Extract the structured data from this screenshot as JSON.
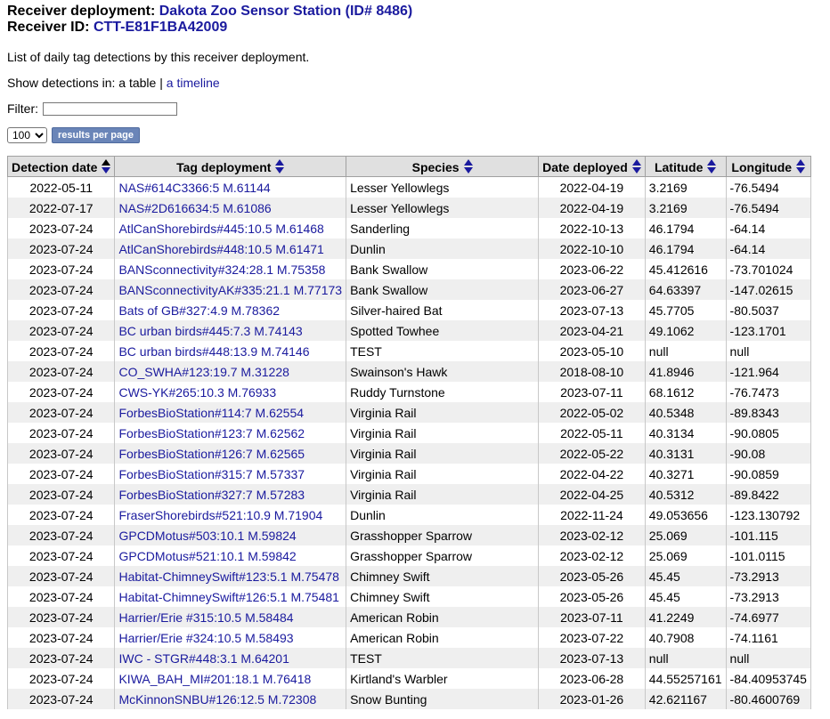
{
  "header": {
    "deployment_label": "Receiver deployment:",
    "deployment_name": "Dakota Zoo Sensor Station (ID# 8486)",
    "receiver_label": "Receiver ID:",
    "receiver_id": "CTT-E81F1BA42009"
  },
  "description": "List of daily tag detections by this receiver deployment.",
  "show": {
    "prefix": "Show detections in: ",
    "table_text": "a table",
    "separator": " | ",
    "timeline_text": "a timeline"
  },
  "filter": {
    "label": "Filter:",
    "value": "",
    "placeholder": ""
  },
  "pager": {
    "page_size": "100",
    "button_label": "results per page"
  },
  "table": {
    "columns": [
      "Detection date",
      "Tag deployment",
      "Species",
      "Date deployed",
      "Latitude",
      "Longitude"
    ],
    "rows": [
      [
        "2022-05-11",
        "NAS#614C3366:5 M.61144",
        "Lesser Yellowlegs",
        "2022-04-19",
        "3.2169",
        "-76.5494"
      ],
      [
        "2022-07-17",
        "NAS#2D616634:5 M.61086",
        "Lesser Yellowlegs",
        "2022-04-19",
        "3.2169",
        "-76.5494"
      ],
      [
        "2023-07-24",
        "AtlCanShorebirds#445:10.5 M.61468",
        "Sanderling",
        "2022-10-13",
        "46.1794",
        "-64.14"
      ],
      [
        "2023-07-24",
        "AtlCanShorebirds#448:10.5 M.61471",
        "Dunlin",
        "2022-10-10",
        "46.1794",
        "-64.14"
      ],
      [
        "2023-07-24",
        "BANSconnectivity#324:28.1 M.75358",
        "Bank Swallow",
        "2023-06-22",
        "45.412616",
        "-73.701024"
      ],
      [
        "2023-07-24",
        "BANSconnectivityAK#335:21.1 M.77173",
        "Bank Swallow",
        "2023-06-27",
        "64.63397",
        "-147.02615"
      ],
      [
        "2023-07-24",
        "Bats of GB#327:4.9 M.78362",
        "Silver-haired Bat",
        "2023-07-13",
        "45.7705",
        "-80.5037"
      ],
      [
        "2023-07-24",
        "BC urban birds#445:7.3 M.74143",
        "Spotted Towhee",
        "2023-04-21",
        "49.1062",
        "-123.1701"
      ],
      [
        "2023-07-24",
        "BC urban birds#448:13.9 M.74146",
        "TEST",
        "2023-05-10",
        "null",
        "null"
      ],
      [
        "2023-07-24",
        "CO_SWHA#123:19.7 M.31228",
        "Swainson's Hawk",
        "2018-08-10",
        "41.8946",
        "-121.964"
      ],
      [
        "2023-07-24",
        "CWS-YK#265:10.3 M.76933",
        "Ruddy Turnstone",
        "2023-07-11",
        "68.1612",
        "-76.7473"
      ],
      [
        "2023-07-24",
        "ForbesBioStation#114:7 M.62554",
        "Virginia Rail",
        "2022-05-02",
        "40.5348",
        "-89.8343"
      ],
      [
        "2023-07-24",
        "ForbesBioStation#123:7 M.62562",
        "Virginia Rail",
        "2022-05-11",
        "40.3134",
        "-90.0805"
      ],
      [
        "2023-07-24",
        "ForbesBioStation#126:7 M.62565",
        "Virginia Rail",
        "2022-05-22",
        "40.3131",
        "-90.08"
      ],
      [
        "2023-07-24",
        "ForbesBioStation#315:7 M.57337",
        "Virginia Rail",
        "2022-04-22",
        "40.3271",
        "-90.0859"
      ],
      [
        "2023-07-24",
        "ForbesBioStation#327:7 M.57283",
        "Virginia Rail",
        "2022-04-25",
        "40.5312",
        "-89.8422"
      ],
      [
        "2023-07-24",
        "FraserShorebirds#521:10.9 M.71904",
        "Dunlin",
        "2022-11-24",
        "49.053656",
        "-123.130792"
      ],
      [
        "2023-07-24",
        "GPCDMotus#503:10.1 M.59824",
        "Grasshopper Sparrow",
        "2023-02-12",
        "25.069",
        "-101.115"
      ],
      [
        "2023-07-24",
        "GPCDMotus#521:10.1 M.59842",
        "Grasshopper Sparrow",
        "2023-02-12",
        "25.069",
        "-101.0115"
      ],
      [
        "2023-07-24",
        "Habitat-ChimneySwift#123:5.1 M.75478",
        "Chimney Swift",
        "2023-05-26",
        "45.45",
        "-73.2913"
      ],
      [
        "2023-07-24",
        "Habitat-ChimneySwift#126:5.1 M.75481",
        "Chimney Swift",
        "2023-05-26",
        "45.45",
        "-73.2913"
      ],
      [
        "2023-07-24",
        "Harrier/Erie #315:10.5 M.58484",
        "American Robin",
        "2023-07-11",
        "41.2249",
        "-74.6977"
      ],
      [
        "2023-07-24",
        "Harrier/Erie #324:10.5 M.58493",
        "American Robin",
        "2023-07-22",
        "40.7908",
        "-74.1161"
      ],
      [
        "2023-07-24",
        "IWC - STGR#448:3.1 M.64201",
        "TEST",
        "2023-07-13",
        "null",
        "null"
      ],
      [
        "2023-07-24",
        "KIWA_BAH_MI#201:18.1 M.76418",
        "Kirtland's Warbler",
        "2023-06-28",
        "44.55257161",
        "-84.40953745"
      ],
      [
        "2023-07-24",
        "McKinnonSNBU#126:12.5 M.72308",
        "Snow Bunting",
        "2023-01-26",
        "42.621167",
        "-80.4600769"
      ]
    ]
  },
  "colors": {
    "link": "#1a1a9e",
    "header_bg": "#e0e0e0",
    "stripe_bg": "#efefef",
    "button_bg": "#6a85b8"
  },
  "icons": {
    "sort": "sort-arrows-icon"
  }
}
